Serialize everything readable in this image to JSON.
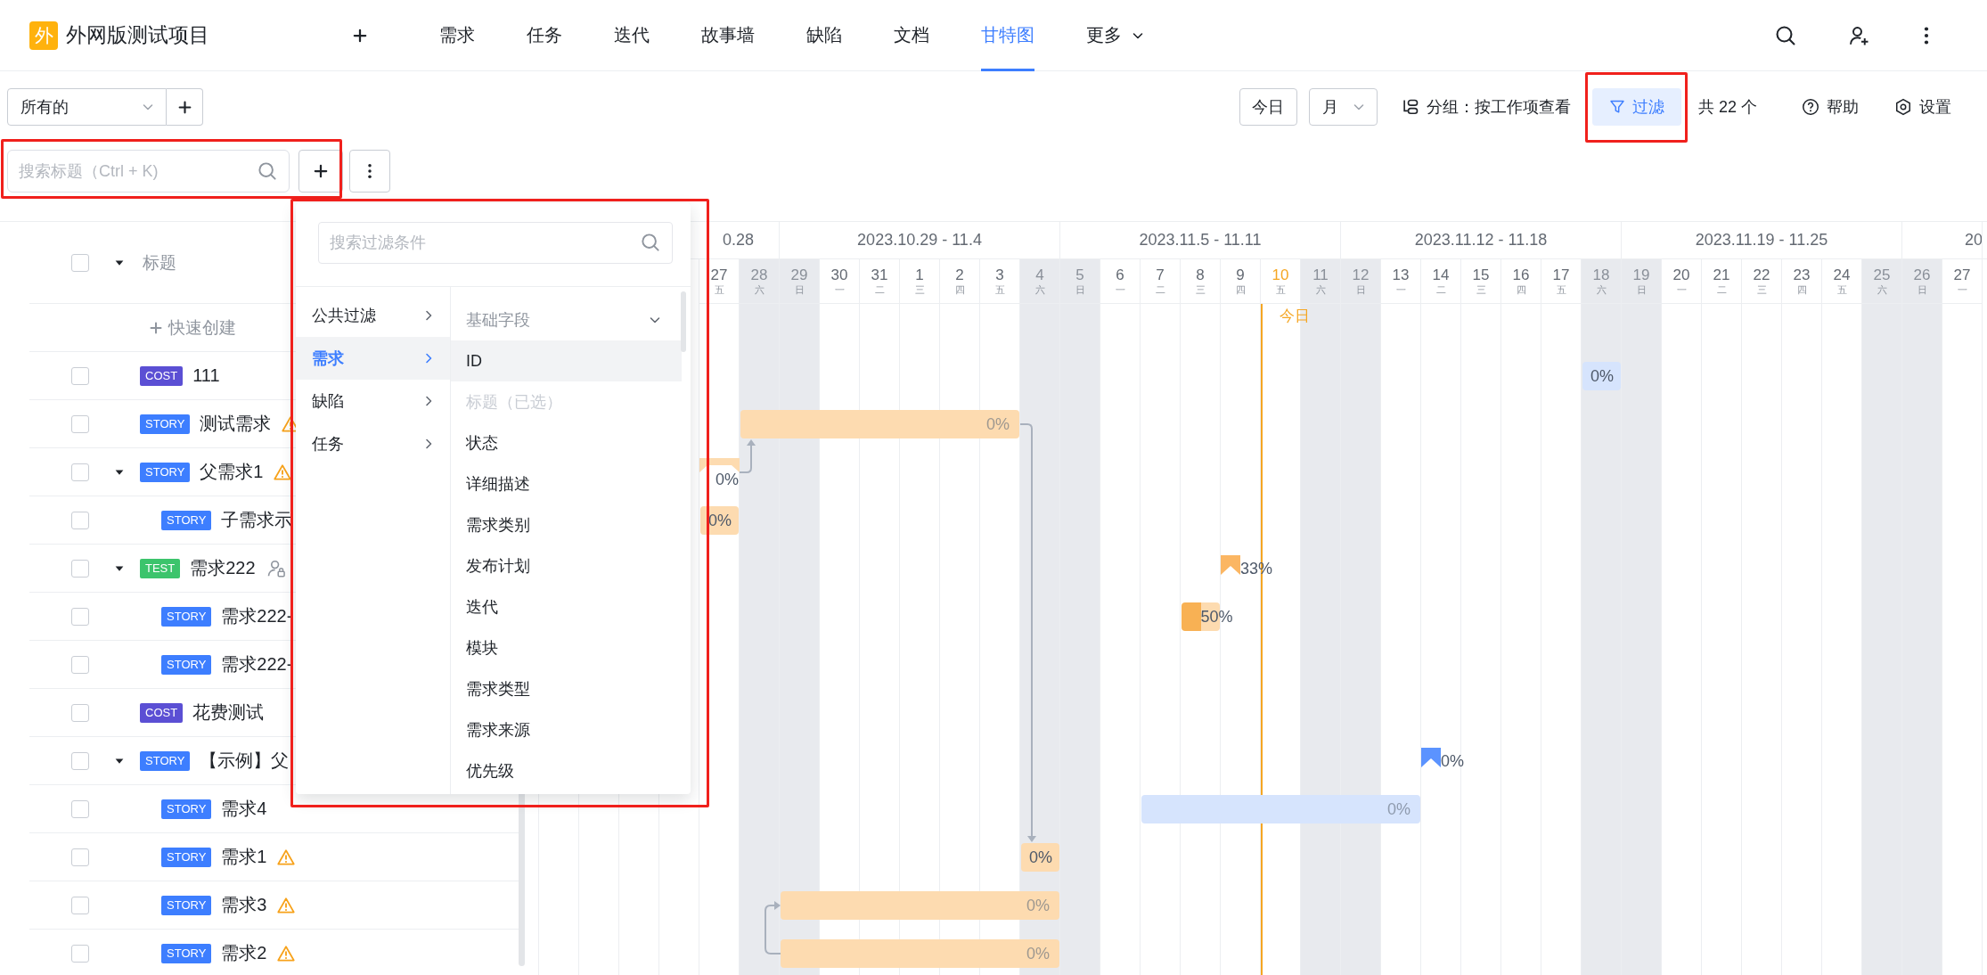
{
  "project": {
    "logo": "外",
    "name": "外网版测试项目"
  },
  "header": {
    "tabs": [
      {
        "label": "需求",
        "selected": false,
        "dropdown": false
      },
      {
        "label": "任务",
        "selected": false,
        "dropdown": false
      },
      {
        "label": "迭代",
        "selected": false,
        "dropdown": false
      },
      {
        "label": "故事墙",
        "selected": false,
        "dropdown": false
      },
      {
        "label": "缺陷",
        "selected": false,
        "dropdown": false
      },
      {
        "label": "文档",
        "selected": false,
        "dropdown": false
      },
      {
        "label": "甘特图",
        "selected": true,
        "dropdown": false
      },
      {
        "label": "更多",
        "selected": false,
        "dropdown": true
      }
    ]
  },
  "toolbar": {
    "view_select": {
      "value": "所有的"
    },
    "today_button": "今日",
    "scale_select": {
      "value": "月"
    },
    "group_by": "分组：按工作项查看",
    "filter_button": {
      "label": "过滤",
      "active": true,
      "highlighted": true
    },
    "total": "共 22 个",
    "help": "帮助",
    "settings": "设置"
  },
  "search": {
    "placeholder": "搜索标题（Ctrl + K)",
    "highlighted": true
  },
  "task_list": {
    "header": "标题",
    "header_checked": false,
    "header_expanded": true,
    "quick_create": "快速创建",
    "rows": [
      {
        "tag": {
          "label": "COST",
          "color": "#5b4fd4"
        },
        "title": "111",
        "checked": false,
        "bar": {
          "kind": "task",
          "color": "#d6e4fd",
          "label": "0%"
        }
      },
      {
        "tag": {
          "label": "STORY",
          "color": "#3d7eff"
        },
        "title": "测试需求",
        "checked": false,
        "warning": true,
        "bar": {
          "kind": "task",
          "color": "#fddbb0",
          "label": "0%"
        }
      },
      {
        "tag": {
          "label": "STORY",
          "color": "#3d7eff"
        },
        "title": "父需求1",
        "checked": false,
        "expanded": true,
        "warning": true,
        "bar": {
          "kind": "summary",
          "color": "#fddbb0",
          "label": "0%"
        },
        "children": [
          {
            "tag": {
              "label": "STORY",
              "color": "#3d7eff"
            },
            "title": "子需求示",
            "checked": false,
            "bar": {
              "kind": "task",
              "color": "#fddbb0",
              "label": "0%"
            }
          }
        ]
      },
      {
        "tag": {
          "label": "TEST",
          "color": "#3cc46c"
        },
        "title": "需求222",
        "checked": false,
        "expanded": true,
        "owner_locked": true,
        "bar": {
          "kind": "flag",
          "color": "#fbb663",
          "label": "33%"
        },
        "children": [
          {
            "tag": {
              "label": "STORY",
              "color": "#3d7eff"
            },
            "title": "需求222-",
            "checked": false,
            "bar": {
              "kind": "task",
              "color": "#fddbb0",
              "level": 0.5,
              "label": "50%"
            }
          },
          {
            "tag": {
              "label": "STORY",
              "color": "#3d7eff"
            },
            "title": "需求222-",
            "checked": false
          }
        ]
      },
      {
        "tag": {
          "label": "COST",
          "color": "#5b4fd4"
        },
        "title": "花费测试",
        "checked": false
      },
      {
        "tag": {
          "label": "STORY",
          "color": "#3d7eff"
        },
        "title": "【示例】父",
        "checked": false,
        "expanded": true,
        "bar": {
          "kind": "flag",
          "color": "#5b93ff",
          "label": "0%"
        },
        "children": [
          {
            "tag": {
              "label": "STORY",
              "color": "#3d7eff"
            },
            "title": "需求4",
            "checked": false,
            "bar": {
              "kind": "task",
              "color": "#d6e4fd",
              "label": "0%"
            }
          },
          {
            "tag": {
              "label": "STORY",
              "color": "#3d7eff"
            },
            "title": "需求1",
            "checked": false,
            "warning": true,
            "bar": {
              "kind": "task",
              "color": "#fddbb0",
              "label": "0%"
            }
          },
          {
            "tag": {
              "label": "STORY",
              "color": "#3d7eff"
            },
            "title": "需求3",
            "checked": false,
            "warning": true,
            "bar": {
              "kind": "task",
              "color": "#fddbb0",
              "label": "0%"
            }
          },
          {
            "tag": {
              "label": "STORY",
              "color": "#3d7eff"
            },
            "title": "需求2",
            "checked": false,
            "warning": true,
            "bar": {
              "kind": "task",
              "color": "#fddbb0",
              "label": "0%"
            }
          }
        ]
      }
    ]
  },
  "gantt": {
    "today_label": "今日",
    "weeks": [
      "0.28",
      "2023.10.29 - 11.4",
      "2023.11.5 - 11.11",
      "2023.11.12 - 11.18",
      "2023.11.19 - 11.25",
      "20"
    ],
    "days": [
      {
        "day": "27",
        "weekday": "五",
        "weekend": false,
        "today": false
      },
      {
        "day": "28",
        "weekday": "六",
        "weekend": true,
        "today": false
      },
      {
        "day": "29",
        "weekday": "日",
        "weekend": true,
        "today": false
      },
      {
        "day": "30",
        "weekday": "一",
        "weekend": false,
        "today": false
      },
      {
        "day": "31",
        "weekday": "二",
        "weekend": false,
        "today": false
      },
      {
        "day": "1",
        "weekday": "三",
        "weekend": false,
        "today": false
      },
      {
        "day": "2",
        "weekday": "四",
        "weekend": false,
        "today": false
      },
      {
        "day": "3",
        "weekday": "五",
        "weekend": false,
        "today": false
      },
      {
        "day": "4",
        "weekday": "六",
        "weekend": true,
        "today": false
      },
      {
        "day": "5",
        "weekday": "日",
        "weekend": true,
        "today": false
      },
      {
        "day": "6",
        "weekday": "一",
        "weekend": false,
        "today": false
      },
      {
        "day": "7",
        "weekday": "二",
        "weekend": false,
        "today": false
      },
      {
        "day": "8",
        "weekday": "三",
        "weekend": false,
        "today": false
      },
      {
        "day": "9",
        "weekday": "四",
        "weekend": false,
        "today": false
      },
      {
        "day": "10",
        "weekday": "五",
        "weekend": false,
        "today": true
      },
      {
        "day": "11",
        "weekday": "六",
        "weekend": true,
        "today": false
      },
      {
        "day": "12",
        "weekday": "日",
        "weekend": true,
        "today": false
      },
      {
        "day": "13",
        "weekday": "一",
        "weekend": false,
        "today": false
      },
      {
        "day": "14",
        "weekday": "二",
        "weekend": false,
        "today": false
      },
      {
        "day": "15",
        "weekday": "三",
        "weekend": false,
        "today": false
      },
      {
        "day": "16",
        "weekday": "四",
        "weekend": false,
        "today": false
      },
      {
        "day": "17",
        "weekday": "五",
        "weekend": false,
        "today": false
      },
      {
        "day": "18",
        "weekday": "六",
        "weekend": true,
        "today": false
      },
      {
        "day": "19",
        "weekday": "日",
        "weekend": true,
        "today": false
      },
      {
        "day": "20",
        "weekday": "一",
        "weekend": false,
        "today": false
      },
      {
        "day": "21",
        "weekday": "二",
        "weekend": false,
        "today": false
      },
      {
        "day": "22",
        "weekday": "三",
        "weekend": false,
        "today": false
      },
      {
        "day": "23",
        "weekday": "四",
        "weekend": false,
        "today": false
      },
      {
        "day": "24",
        "weekday": "五",
        "weekend": false,
        "today": false
      },
      {
        "day": "25",
        "weekday": "六",
        "weekend": true,
        "today": false
      },
      {
        "day": "26",
        "weekday": "日",
        "weekend": true,
        "today": false
      },
      {
        "day": "27",
        "weekday": "一",
        "weekend": false,
        "today": false
      }
    ]
  },
  "filter_menu": {
    "highlighted": true,
    "placeholder": "搜索过滤条件",
    "categories": [
      {
        "label": "公共过滤",
        "selected": false
      },
      {
        "label": "需求",
        "selected": true
      },
      {
        "label": "缺陷",
        "selected": false
      },
      {
        "label": "任务",
        "selected": false
      }
    ],
    "group": {
      "label": "基础字段",
      "expanded": true
    },
    "fields": [
      {
        "label": "ID",
        "selected": true,
        "disabled": false
      },
      {
        "label": "标题（已选）",
        "selected": false,
        "disabled": true
      },
      {
        "label": "状态",
        "selected": false,
        "disabled": false
      },
      {
        "label": "详细描述",
        "selected": false,
        "disabled": false
      },
      {
        "label": "需求类别",
        "selected": false,
        "disabled": false
      },
      {
        "label": "发布计划",
        "selected": false,
        "disabled": false
      },
      {
        "label": "迭代",
        "selected": false,
        "disabled": false
      },
      {
        "label": "模块",
        "selected": false,
        "disabled": false
      },
      {
        "label": "需求类型",
        "selected": false,
        "disabled": false
      },
      {
        "label": "需求来源",
        "selected": false,
        "disabled": false
      },
      {
        "label": "优先级",
        "selected": false,
        "disabled": false
      }
    ]
  }
}
